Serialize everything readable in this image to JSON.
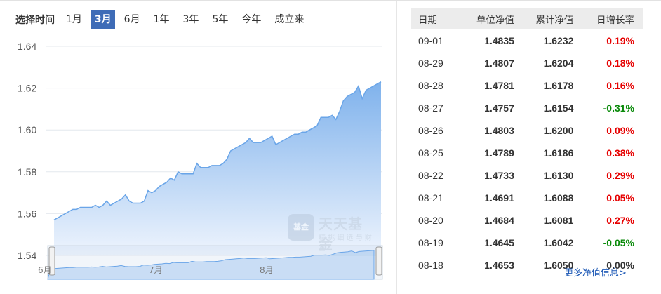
{
  "range_selector": {
    "label": "选择时间",
    "options": [
      "1月",
      "3月",
      "6月",
      "1年",
      "3年",
      "5年",
      "今年",
      "成立来"
    ],
    "active_index": 1,
    "active_color": "#3e6cb7"
  },
  "watermark": {
    "badge": "基金",
    "title": "天天基金",
    "subtitle": "精 挑 细 选 与 财 富"
  },
  "navigator": {
    "month_labels": [
      "6月",
      "7月",
      "8月"
    ]
  },
  "table": {
    "headers": [
      "日期",
      "单位净值",
      "累计净值",
      "日增长率"
    ],
    "rows": [
      {
        "date": "09-01",
        "unit": "1.4835",
        "accum": "1.6232",
        "rate": "0.19%",
        "dir": "up"
      },
      {
        "date": "08-29",
        "unit": "1.4807",
        "accum": "1.6204",
        "rate": "0.18%",
        "dir": "up"
      },
      {
        "date": "08-28",
        "unit": "1.4781",
        "accum": "1.6178",
        "rate": "0.16%",
        "dir": "up"
      },
      {
        "date": "08-27",
        "unit": "1.4757",
        "accum": "1.6154",
        "rate": "-0.31%",
        "dir": "down"
      },
      {
        "date": "08-26",
        "unit": "1.4803",
        "accum": "1.6200",
        "rate": "0.09%",
        "dir": "up"
      },
      {
        "date": "08-25",
        "unit": "1.4789",
        "accum": "1.6186",
        "rate": "0.38%",
        "dir": "up"
      },
      {
        "date": "08-22",
        "unit": "1.4733",
        "accum": "1.6130",
        "rate": "0.29%",
        "dir": "up"
      },
      {
        "date": "08-21",
        "unit": "1.4691",
        "accum": "1.6088",
        "rate": "0.05%",
        "dir": "up"
      },
      {
        "date": "08-20",
        "unit": "1.4684",
        "accum": "1.6081",
        "rate": "0.27%",
        "dir": "up"
      },
      {
        "date": "08-19",
        "unit": "1.4645",
        "accum": "1.6042",
        "rate": "-0.05%",
        "dir": "down"
      },
      {
        "date": "08-18",
        "unit": "1.4653",
        "accum": "1.6050",
        "rate": "0.00%",
        "dir": "flat"
      }
    ],
    "more_link": "更多净值信息>"
  },
  "colors": {
    "up": "#e60000",
    "down": "#0a8a0a",
    "flat": "#333333",
    "area_top": "#7fb2ec",
    "area_bottom": "#eef4fd",
    "line": "#6aa5e8"
  },
  "chart_data": {
    "type": "area",
    "ylim": [
      1.54,
      1.64
    ],
    "y_ticks": [
      "1.64",
      "1.62",
      "1.60",
      "1.58",
      "1.56",
      "1.54"
    ],
    "grid": true,
    "series": [
      {
        "values": [
          1.557,
          1.558,
          1.559,
          1.56,
          1.561,
          1.562,
          1.562,
          1.563,
          1.563,
          1.563,
          1.563,
          1.564,
          1.563,
          1.564,
          1.566,
          1.564,
          1.565,
          1.566,
          1.567,
          1.569,
          1.566,
          1.565,
          1.565,
          1.565,
          1.566,
          1.571,
          1.57,
          1.571,
          1.573,
          1.574,
          1.575,
          1.577,
          1.576,
          1.58,
          1.579,
          1.579,
          1.579,
          1.579,
          1.584,
          1.582,
          1.582,
          1.582,
          1.583,
          1.583,
          1.583,
          1.584,
          1.586,
          1.59,
          1.591,
          1.592,
          1.593,
          1.594,
          1.596,
          1.594,
          1.594,
          1.594,
          1.595,
          1.596,
          1.597,
          1.593,
          1.594,
          1.595,
          1.596,
          1.597,
          1.598,
          1.598,
          1.599,
          1.599,
          1.6,
          1.601,
          1.602,
          1.606,
          1.606,
          1.606,
          1.607,
          1.605,
          1.609,
          1.614,
          1.616,
          1.617,
          1.618,
          1.621,
          1.615,
          1.619,
          1.62,
          1.621,
          1.622,
          1.623
        ]
      }
    ]
  }
}
